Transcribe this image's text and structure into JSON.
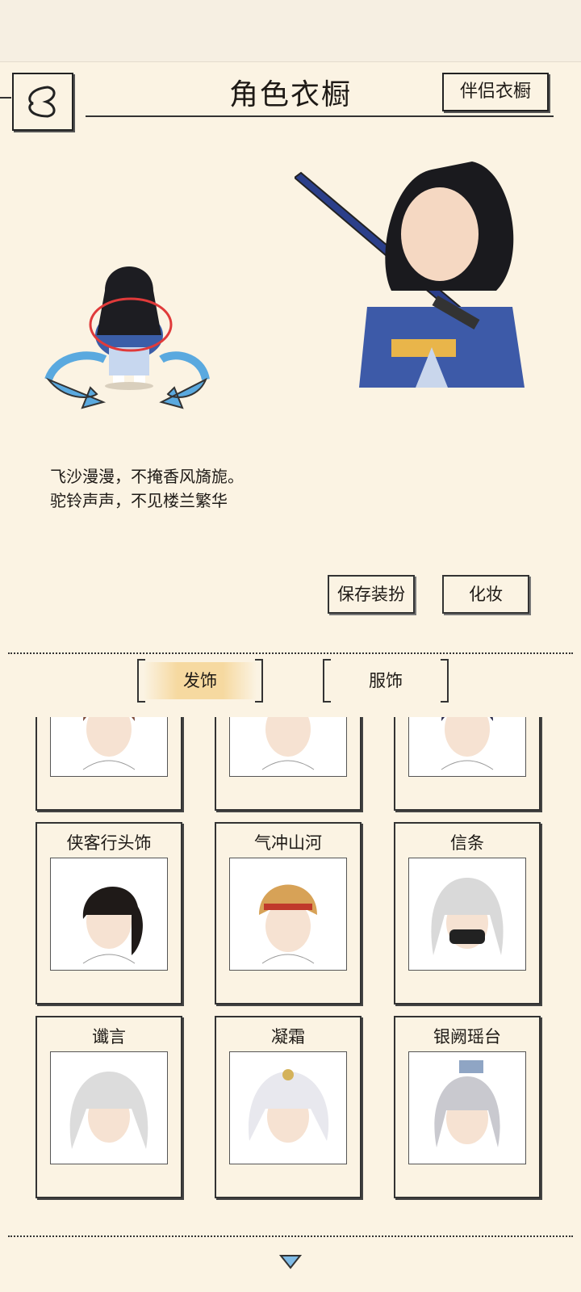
{
  "header": {
    "title": "角色衣橱",
    "companion_label": "伴侣衣橱"
  },
  "poem": {
    "line1": "飞沙漫漫，不掩香风旖旎。",
    "line2": "驼铃声声，不见楼兰繁华"
  },
  "actions": {
    "save_label": "保存装扮",
    "makeup_label": "化妆"
  },
  "tabs": [
    {
      "label": "发饰",
      "active": true
    },
    {
      "label": "服饰",
      "active": false
    }
  ],
  "grid": {
    "items": [
      {
        "name": "",
        "hair_color": "#7b4a3a"
      },
      {
        "name": "",
        "hair_color": "#2b2b2b"
      },
      {
        "name": "",
        "hair_color": "#2a2a4a"
      },
      {
        "name": "侠客行头饰",
        "hair_color": "#1f1a18"
      },
      {
        "name": "气冲山河",
        "hair_color": "#d7a257"
      },
      {
        "name": "信条",
        "hair_color": "#d9d9d9"
      },
      {
        "name": "谶言",
        "hair_color": "#dcdcdc"
      },
      {
        "name": "凝霜",
        "hair_color": "#e8e8ee"
      },
      {
        "name": "银阙瑶台",
        "hair_color": "#c9c9cf"
      }
    ]
  },
  "colors": {
    "background": "#fbf3e3",
    "active_tab": "#f6d9a0",
    "arrow_blue": "#5aa9df",
    "highlight_circle": "#e03a3a"
  }
}
